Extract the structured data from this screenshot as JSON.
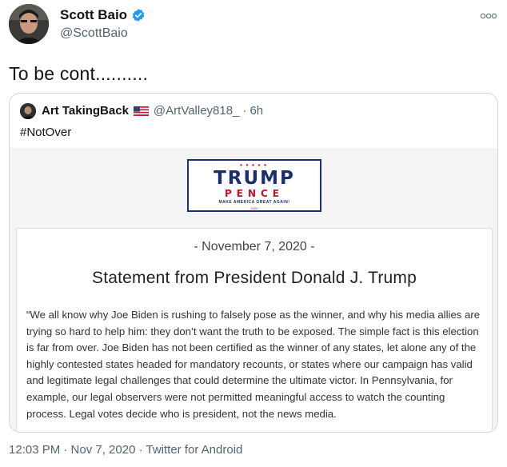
{
  "author": {
    "name": "Scott Baio",
    "handle": "@ScottBaio",
    "verified": true,
    "verified_color": "#1d9bf0",
    "avatar_icon": "profile-photo"
  },
  "more_icon": "ellipsis-icon",
  "tweet_text": "To be cont..........",
  "quoted": {
    "name": "Art TakingBack",
    "flag_icon": "us-flag-icon",
    "handle": "@ArtValley818_",
    "separator": "·",
    "time": "6h",
    "text": "#NotOver",
    "image": {
      "logo": {
        "trump": "TRUMP",
        "pence": "PENCE",
        "slogan": "MAKE AMERICA GREAT AGAIN!",
        "year": "2020",
        "stars": "★★★★★",
        "navy": "#1b2f6b",
        "red": "#c8102e"
      },
      "date": "- November 7, 2020 -",
      "title": "Statement from President Donald J. Trump",
      "body": "“We all know why Joe Biden is rushing to falsely pose as the winner, and why his media allies are trying so hard to help him: they don’t want the truth to be exposed. The simple fact is this election is far from over. Joe Biden has not been certified as the winner of any states, let alone any of the highly contested states headed for mandatory recounts, or states where our campaign has valid and legitimate legal challenges that could determine the ultimate victor. In Pennsylvania, for example, our legal observers were not permitted meaningful access to watch the counting process. Legal votes decide who is president, not the news media."
    }
  },
  "footer": "12:03 PM · Nov 7, 2020 · Twitter for Android"
}
